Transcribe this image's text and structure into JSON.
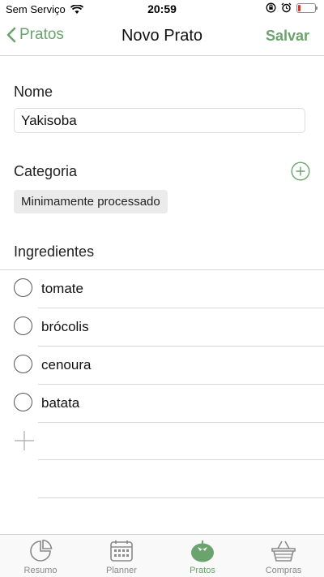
{
  "status_bar": {
    "carrier": "Sem Serviço",
    "time": "20:59",
    "battery_level": 0.15
  },
  "nav": {
    "back_label": "Pratos",
    "title": "Novo Prato",
    "save_label": "Salvar"
  },
  "form": {
    "name_label": "Nome",
    "name_value": "Yakisoba",
    "category_label": "Categoria",
    "category_value": "Minimamente processado",
    "ingredients_label": "Ingredientes",
    "ingredients": [
      {
        "name": "tomate"
      },
      {
        "name": "brócolis"
      },
      {
        "name": "cenoura"
      },
      {
        "name": "batata"
      }
    ]
  },
  "tabs": [
    {
      "label": "Resumo",
      "icon": "pie-chart-icon",
      "active": false
    },
    {
      "label": "Planner",
      "icon": "calendar-icon",
      "active": false
    },
    {
      "label": "Pratos",
      "icon": "tomato-icon",
      "active": true
    },
    {
      "label": "Compras",
      "icon": "basket-icon",
      "active": false
    }
  ],
  "colors": {
    "accent": "#6aa36c",
    "inactive": "#888888",
    "battery_low": "#e0302a"
  }
}
